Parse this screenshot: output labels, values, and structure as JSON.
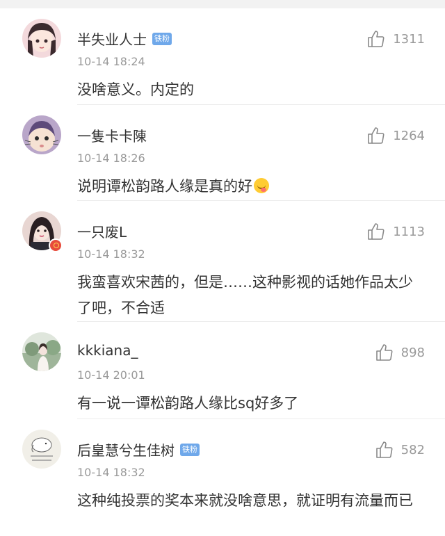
{
  "comments": [
    {
      "name": "半失业人士",
      "badge": "铁粉",
      "time": "10-14 18:24",
      "text": "没啥意义。内定的",
      "likes": "1311",
      "avatar": "avatar-girl-cartoon"
    },
    {
      "name": "一隻卡卡陳",
      "badge": "",
      "time": "10-14 18:26",
      "text": "说明谭松韵路人缘是真的好",
      "emoji": "smirk-face-emoji",
      "likes": "1264",
      "avatar": "avatar-baby"
    },
    {
      "name": "一只废L",
      "badge": "",
      "time": "10-14 18:32",
      "text": "我蛮喜欢宋茜的，但是……这种影视的话她作品太少了吧，不合适",
      "likes": "1113",
      "avatar": "avatar-girl-photo"
    },
    {
      "name": "kkkiana_",
      "badge": "",
      "time": "10-14 20:01",
      "text": "有一说一谭松韵路人缘比sq好多了",
      "likes": "898",
      "avatar": "avatar-landscape"
    },
    {
      "name": "后皇慧兮生佳树",
      "badge": "铁粉",
      "time": "10-14 18:32",
      "text": "这种纯投票的奖本来就没啥意思，就证明有流量而已",
      "likes": "582",
      "avatar": "avatar-elephant-sticker"
    }
  ],
  "colors": {
    "badge": "#6fa8ea",
    "secondary_text": "#999999",
    "primary_text": "#333333"
  }
}
